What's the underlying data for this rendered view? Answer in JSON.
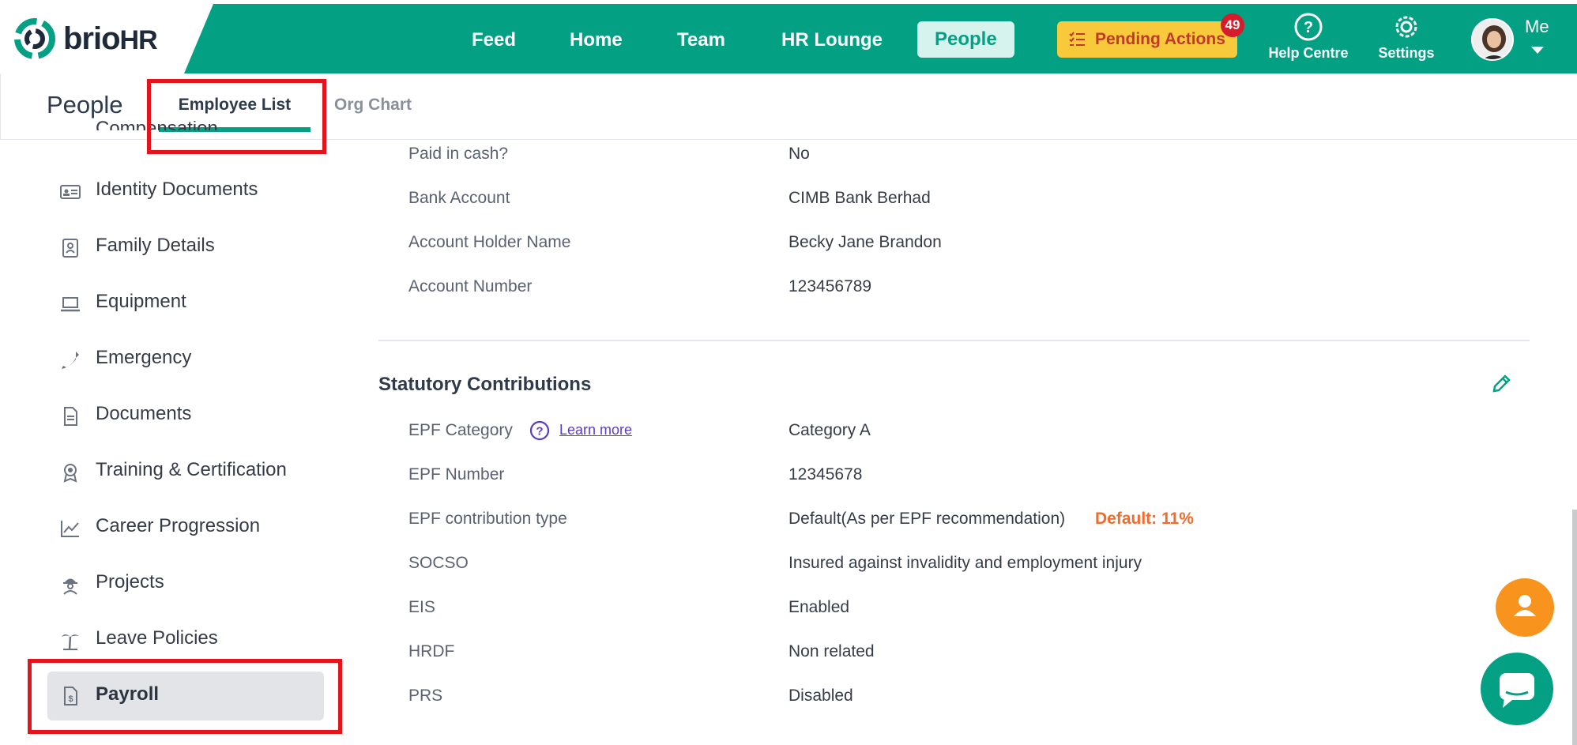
{
  "brand": {
    "name_brio": "brio",
    "name_hr": "HR"
  },
  "nav": {
    "feed": "Feed",
    "home": "Home",
    "team": "Team",
    "hr_lounge": "HR Lounge",
    "people": "People"
  },
  "pending": {
    "label": "Pending Actions",
    "count": "49"
  },
  "help": {
    "label": "Help Centre"
  },
  "settings": {
    "label": "Settings"
  },
  "me": {
    "label": "Me"
  },
  "subheader": {
    "title": "People",
    "tab_employee": "Employee List",
    "tab_org": "Org Chart"
  },
  "sidebar": {
    "items": [
      {
        "label": "Compensation"
      },
      {
        "label": "Identity Documents"
      },
      {
        "label": "Family Details"
      },
      {
        "label": "Equipment"
      },
      {
        "label": "Emergency"
      },
      {
        "label": "Documents"
      },
      {
        "label": "Training & Certification"
      },
      {
        "label": "Career Progression"
      },
      {
        "label": "Projects"
      },
      {
        "label": "Leave Policies"
      },
      {
        "label": "Payroll"
      }
    ]
  },
  "bank": {
    "rows": [
      {
        "label": "Paid in cash?",
        "value": "No"
      },
      {
        "label": "Bank Account",
        "value": "CIMB Bank Berhad"
      },
      {
        "label": "Account Holder Name",
        "value": "Becky Jane Brandon"
      },
      {
        "label": "Account Number",
        "value": "123456789"
      }
    ]
  },
  "statutory": {
    "title": "Statutory Contributions",
    "learn_more": "Learn more",
    "epf_default": "Default: 11%",
    "rows": [
      {
        "label": "EPF Category",
        "value": "Category A"
      },
      {
        "label": "EPF Number",
        "value": "12345678"
      },
      {
        "label": "EPF contribution type",
        "value": "Default(As per EPF recommendation)"
      },
      {
        "label": "SOCSO",
        "value": "Insured against invalidity and employment injury"
      },
      {
        "label": "EIS",
        "value": "Enabled"
      },
      {
        "label": "HRDF",
        "value": "Non related"
      },
      {
        "label": "PRS",
        "value": "Disabled"
      }
    ]
  },
  "colors": {
    "brand_green": "#04a084",
    "pending_yellow": "#f9c93c",
    "badge_red": "#d61b2b",
    "highlight_red": "#e3141c",
    "fab_orange": "#f8931d",
    "accent_orange": "#f26b2c"
  }
}
